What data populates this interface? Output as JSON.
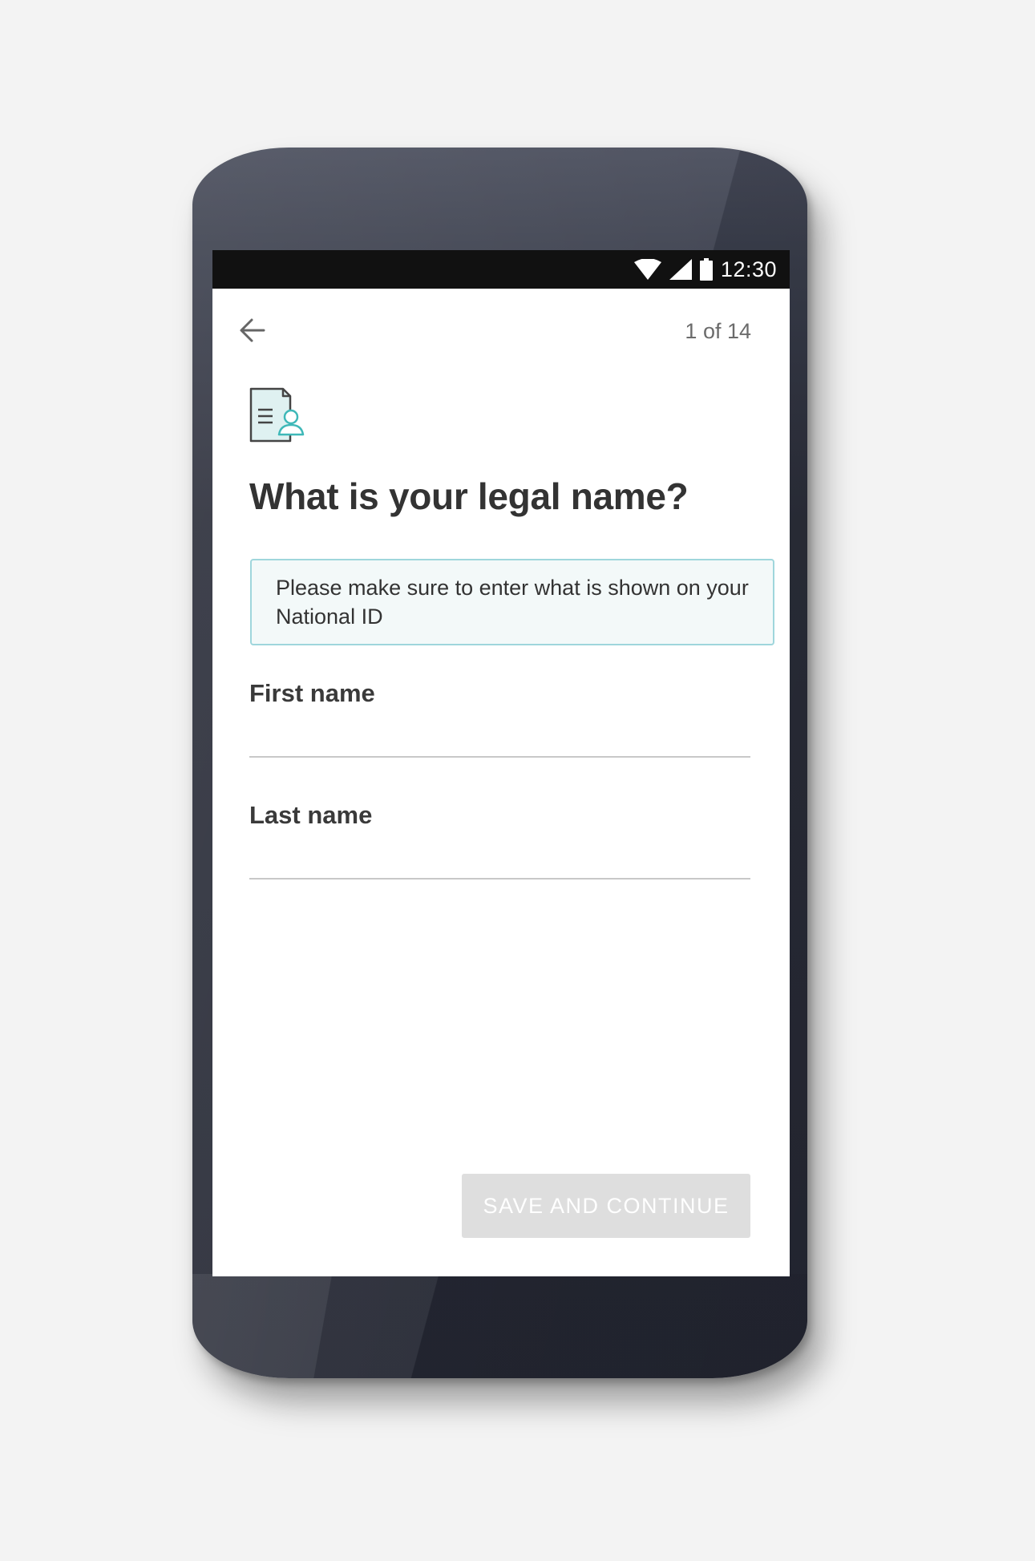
{
  "status_bar": {
    "time": "12:30",
    "icons": [
      "wifi-icon",
      "cell-signal-icon",
      "battery-icon"
    ]
  },
  "header": {
    "back_icon": "arrow-left-icon",
    "step_counter": "1 of 14"
  },
  "main": {
    "icon": "id-document-icon",
    "title": "What is your legal name?",
    "info_message": "Please make sure to enter what is shown on your National ID",
    "fields": [
      {
        "label": "First name",
        "value": "",
        "placeholder": ""
      },
      {
        "label": "Last name",
        "value": "",
        "placeholder": ""
      }
    ]
  },
  "footer": {
    "save_label": "SAVE AND CONTINUE"
  },
  "colors": {
    "accent_teal": "#3fb8b8",
    "info_border": "#9fd6dc",
    "info_background": "#f3f9f9",
    "button_disabled": "#dedede",
    "text_dark": "#333333"
  }
}
